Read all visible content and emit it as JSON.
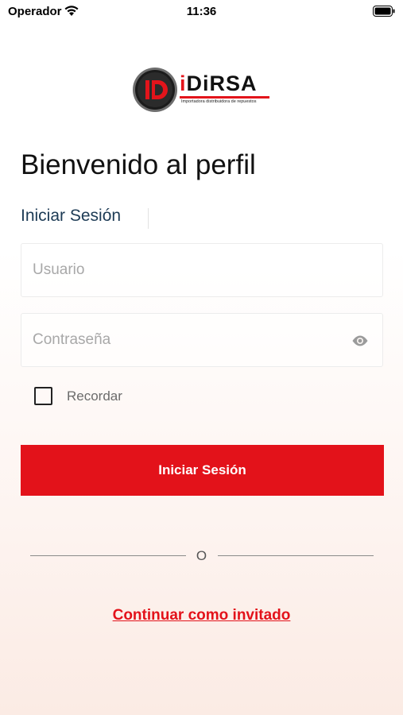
{
  "status_bar": {
    "carrier": "Operador",
    "time": "11:36"
  },
  "logo": {
    "brand_prefix": "i",
    "brand_main": "DiRSA",
    "tagline": "Importadora distribuidora de repuestos",
    "emblem_letter": "iD"
  },
  "page": {
    "title": "Bienvenido al perfil",
    "tab_label": "Iniciar Sesión"
  },
  "form": {
    "username_placeholder": "Usuario",
    "username_value": "",
    "password_placeholder": "Contraseña",
    "password_value": "",
    "remember_label": "Recordar",
    "remember_checked": false,
    "submit_label": "Iniciar Sesión"
  },
  "divider": {
    "text": "O"
  },
  "guest": {
    "label": "Continuar como invitado"
  },
  "colors": {
    "accent": "#e3121a",
    "tab_text": "#1d3b55"
  },
  "icons": {
    "wifi": "wifi-icon",
    "battery": "battery-icon",
    "eye": "eye-icon"
  }
}
